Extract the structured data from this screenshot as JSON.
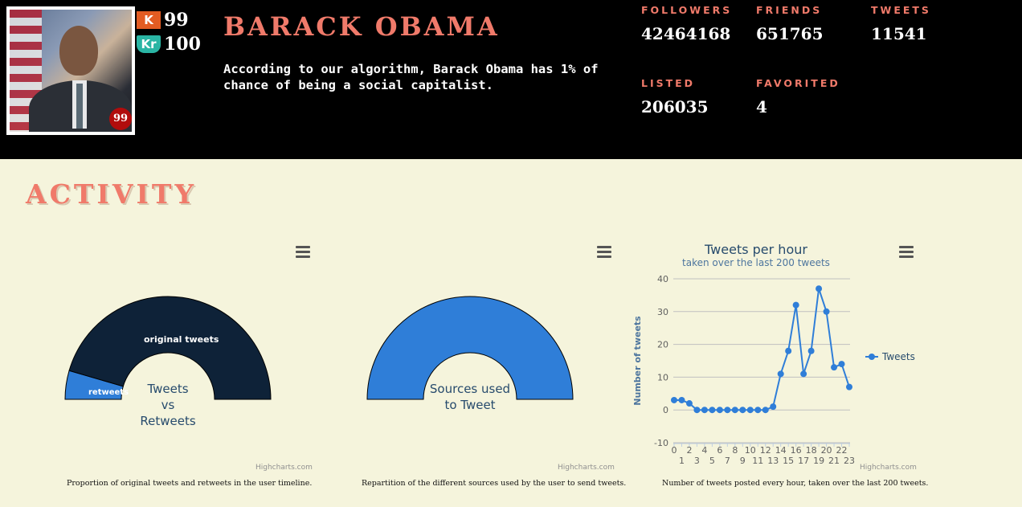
{
  "profile": {
    "name": "BARACK OBAMA",
    "description": "According to our algorithm, Barack Obama has 1% of chance of being a social capitalist.",
    "photo_badge": "99",
    "klout_icon": "klout-icon",
    "klout_score": "99",
    "kred_icon": "kred-icon",
    "kred_score": "100"
  },
  "stats": {
    "followers_label": "FOLLOWERS",
    "followers": "42464168",
    "friends_label": "FRIENDS",
    "friends": "651765",
    "tweets_label": "TWEETS",
    "tweets": "11541",
    "listed_label": "LISTED",
    "listed": "206035",
    "favorited_label": "FAVORITED",
    "favorited": "4"
  },
  "activity_title": "ACTIVITY",
  "charts": {
    "credits": "Highcharts.com",
    "menu_icon": "hamburger-menu-icon",
    "captions": [
      "Proportion of original tweets and retweets in the user timeline.",
      "Repartition of the different sources used by the user to send tweets.",
      "Number of tweets posted every hour, taken over the last 200 tweets."
    ]
  },
  "colors": {
    "accent": "#f07a6a",
    "dark_navy": "#0e2238",
    "blue": "#2f7ed8",
    "background": "#f5f4dc"
  },
  "chart_data": [
    {
      "type": "pie",
      "title": "Tweets vs Retweets",
      "title_lines": [
        "Tweets",
        "vs",
        "Retweets"
      ],
      "categories": [
        "retweets",
        "original tweets"
      ],
      "values": [
        9,
        91
      ],
      "colors": [
        "#2f7ed8",
        "#0e2238"
      ]
    },
    {
      "type": "pie",
      "title": "Sources used to Tweet",
      "title_lines": [
        "Sources used",
        "to Tweet"
      ],
      "categories": [
        ""
      ],
      "values": [
        100
      ],
      "colors": [
        "#2f7ed8"
      ]
    },
    {
      "type": "line",
      "title": "Tweets per hour",
      "subtitle": "taken over the last 200 tweets",
      "ylabel": "Number of tweets",
      "xlabel": "",
      "x": [
        0,
        1,
        2,
        3,
        4,
        5,
        6,
        7,
        8,
        9,
        10,
        11,
        12,
        13,
        14,
        15,
        16,
        17,
        18,
        19,
        20,
        21,
        22,
        23
      ],
      "series": [
        {
          "name": "Tweets",
          "values": [
            3,
            3,
            2,
            0,
            0,
            0,
            0,
            0,
            0,
            0,
            0,
            0,
            0,
            1,
            11,
            18,
            32,
            11,
            18,
            37,
            30,
            13,
            14,
            7
          ]
        }
      ],
      "ylim": [
        -10,
        40
      ],
      "yticks": [
        -10,
        0,
        10,
        20,
        30,
        40
      ],
      "xticks_upper": [
        "0",
        "2",
        "4",
        "6",
        "8",
        "10",
        "12",
        "14",
        "16",
        "18",
        "20",
        "22"
      ],
      "xticks_lower": [
        "1",
        "3",
        "5",
        "7",
        "9",
        "11",
        "13",
        "15",
        "17",
        "19",
        "21",
        "23"
      ],
      "legend": "right",
      "grid": true
    }
  ]
}
